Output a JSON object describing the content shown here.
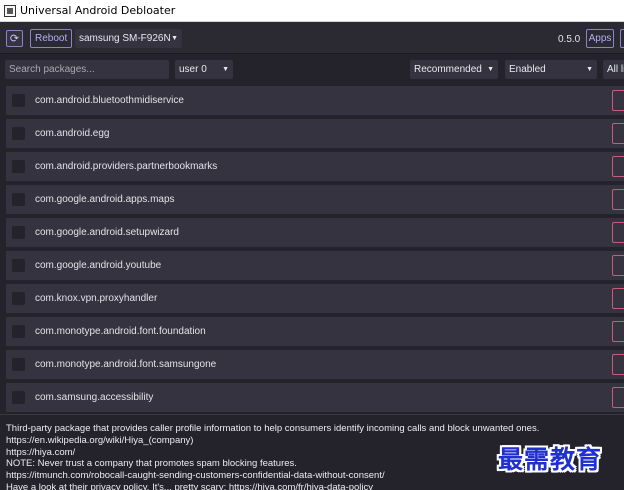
{
  "window": {
    "title": "Universal Android Debloater"
  },
  "toolbar": {
    "refresh_icon": "refresh-icon",
    "reboot_label": "Reboot",
    "device": "samsung SM-F926N",
    "version": "0.5.0",
    "apps_label": "Apps"
  },
  "filters": {
    "search_placeholder": "Search packages...",
    "user": "user 0",
    "list": "Recommended",
    "state": "Enabled",
    "all": "All li"
  },
  "packages": [
    {
      "name": "com.android.bluetoothmidiservice"
    },
    {
      "name": "com.android.egg"
    },
    {
      "name": "com.android.providers.partnerbookmarks"
    },
    {
      "name": "com.google.android.apps.maps"
    },
    {
      "name": "com.google.android.setupwizard"
    },
    {
      "name": "com.google.android.youtube"
    },
    {
      "name": "com.knox.vpn.proxyhandler"
    },
    {
      "name": "com.monotype.android.font.foundation"
    },
    {
      "name": "com.monotype.android.font.samsungone"
    },
    {
      "name": "com.samsung.accessibility"
    }
  ],
  "description": {
    "lines": [
      "Third-party package that provides caller profile information to help consumers identify incoming calls and block unwanted ones.",
      "https://en.wikipedia.org/wiki/Hiya_(company)",
      "https://hiya.com/",
      "NOTE: Never trust a company that promotes spam blocking features.",
      "https://itmunch.com/robocall-caught-sending-customers-confidential-data-without-consent/",
      "Have a look at their privacy policy. It's... pretty scary: https://hiya.com/fr/hiya-data-policy"
    ]
  },
  "watermark": "最需教育",
  "colors": {
    "background": "#24232c",
    "row": "#34333f",
    "accent": "#8a84c8",
    "danger": "#c85a7a"
  }
}
